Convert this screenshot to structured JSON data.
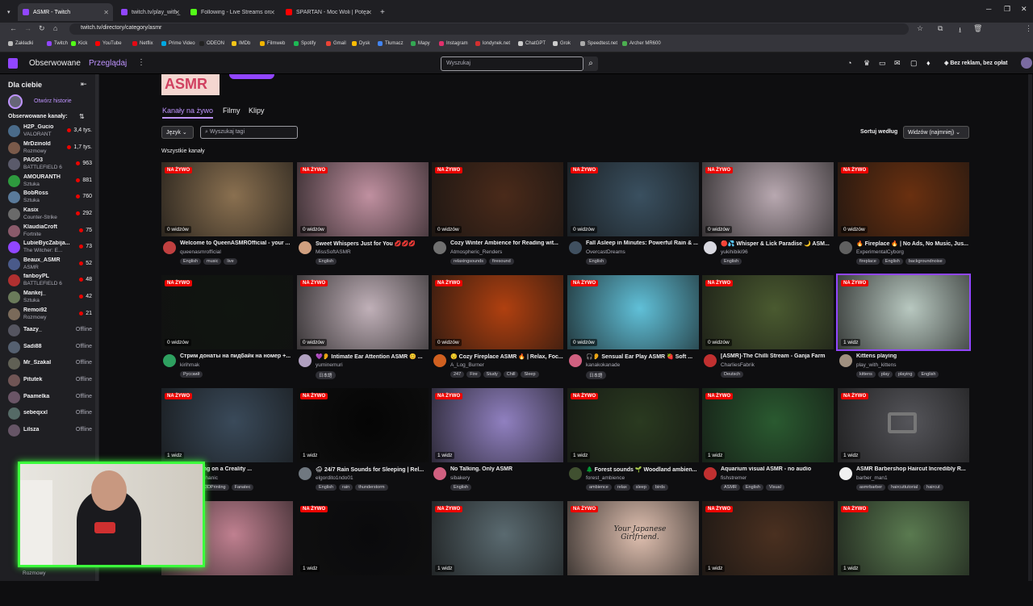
{
  "browser": {
    "tabs": [
      {
        "label": "ASMR - Twitch",
        "color": "#9146ff"
      },
      {
        "label": "twitch.tv/play_with_",
        "color": "#9146ff"
      },
      {
        "label": "Following - Live Streams on Kick",
        "color": "#53fc18"
      },
      {
        "label": "SPARTAN - Moc Woli | Potężna",
        "color": "#ff0000"
      }
    ],
    "url": "twitch.tv/directory/category/asmr",
    "bookmarks": [
      {
        "label": "Zakładki",
        "color": "#bbbbbb"
      },
      {
        "label": "Twitch",
        "color": "#9146ff"
      },
      {
        "label": "Kick",
        "color": "#53fc18"
      },
      {
        "label": "YouTube",
        "color": "#ff0000"
      },
      {
        "label": "Netflix",
        "color": "#e50914"
      },
      {
        "label": "Prime Video",
        "color": "#00a8e1"
      },
      {
        "label": "ODEON",
        "color": "#222222"
      },
      {
        "label": "IMDb",
        "color": "#f5c518"
      },
      {
        "label": "Filmweb",
        "color": "#f0b400"
      },
      {
        "label": "Spotify",
        "color": "#1db954"
      },
      {
        "label": "Gmail",
        "color": "#ea4335"
      },
      {
        "label": "Dysk",
        "color": "#fbbc04"
      },
      {
        "label": "Tłumacz",
        "color": "#4285f4"
      },
      {
        "label": "Mapy",
        "color": "#34a853"
      },
      {
        "label": "Instagram",
        "color": "#e1306c"
      },
      {
        "label": "londynek.net",
        "color": "#d32f2f"
      },
      {
        "label": "ChatGPT",
        "color": "#cccccc"
      },
      {
        "label": "Grok",
        "color": "#cccccc"
      },
      {
        "label": "Speedtest.net",
        "color": "#aaaaaa"
      },
      {
        "label": "Archer MR600",
        "color": "#4caf50"
      }
    ]
  },
  "twitch_nav": {
    "following": "Obserwowane",
    "browse": "Przeglądaj",
    "search_placeholder": "Wyszukaj",
    "no_ads": "Bez reklam, bez opłat"
  },
  "sidebar": {
    "for_you": "Dla ciebie",
    "open_stories": "Otwórz historie",
    "followed_header": "Obserwowane kanały:",
    "channels": [
      {
        "name": "H2P_Gucio",
        "game": "VALORANT",
        "viewers": "3,4 tys.",
        "color": "#4a6b8a"
      },
      {
        "name": "MrDzinold",
        "game": "Rozmowy",
        "viewers": "1,7 tys.",
        "color": "#7a5a4a"
      },
      {
        "name": "PAGO3",
        "game": "BATTLEFIELD 6",
        "viewers": "963",
        "color": "#5a5a6a"
      },
      {
        "name": "AMOURANTH",
        "game": "Sztuka",
        "viewers": "881",
        "color": "#2e9a3e"
      },
      {
        "name": "BobRoss",
        "game": "Sztuka",
        "viewers": "760",
        "color": "#5a7a9a"
      },
      {
        "name": "Kasix",
        "game": "Counter-Strike",
        "viewers": "292",
        "color": "#6a6a6a"
      },
      {
        "name": "KlaudiaCroft",
        "game": "Fortnite",
        "viewers": "75",
        "color": "#8a5a6a"
      },
      {
        "name": "LubieBycZabija...",
        "game": "The Witcher: E...",
        "viewers": "73",
        "color": "#9146ff"
      },
      {
        "name": "Beaux_ASMR",
        "game": "ASMR",
        "viewers": "52",
        "color": "#4a5a8a"
      },
      {
        "name": "fanboyPL",
        "game": "BATTLEFIELD 6",
        "viewers": "48",
        "color": "#b03030"
      },
      {
        "name": "Mankej_",
        "game": "Sztuka",
        "viewers": "42",
        "color": "#6a7a5a"
      },
      {
        "name": "Remoi92",
        "game": "Rozmowy",
        "viewers": "21",
        "color": "#7a6a5a"
      },
      {
        "name": "Taazy_",
        "game": "",
        "viewers": "Offline",
        "color": "#555560"
      },
      {
        "name": "Sadi88",
        "game": "",
        "viewers": "Offline",
        "color": "#556070"
      },
      {
        "name": "Mr_Szakal",
        "game": "",
        "viewers": "Offline",
        "color": "#606055"
      },
      {
        "name": "Pitutek",
        "game": "",
        "viewers": "Offline",
        "color": "#705555"
      },
      {
        "name": "Paamelka",
        "game": "",
        "viewers": "Offline",
        "color": "#6a5566"
      },
      {
        "name": "sebeqxxl",
        "game": "",
        "viewers": "Offline",
        "color": "#556a66"
      },
      {
        "name": "Lilsza",
        "game": "",
        "viewers": "Offline",
        "color": "#665566"
      }
    ]
  },
  "page": {
    "category_title": "ASMR",
    "tabs": [
      "Kanały na żywo",
      "Filmy",
      "Klipy"
    ],
    "lang_label": "Język",
    "tag_search_placeholder": "Wyszukaj tagi",
    "sort_label": "Sortuj według",
    "sort_value": "Widzów (najmniej)",
    "section_label": "Wszystkie kanały"
  },
  "live_badge": "NA ŻYWO",
  "streams": [
    {
      "title": "Welcome to QueenASMROfficial - your ...",
      "channel": "queenasmrofficial",
      "viewers": "0 widzów",
      "tags": [
        "English",
        "music",
        "live"
      ],
      "bg": "#8a7050",
      "av": "#c04040"
    },
    {
      "title": "Sweet Whispers Just for You 💋💋💋",
      "channel": "MissSoftASMR",
      "viewers": "0 widzów",
      "tags": [
        "English"
      ],
      "bg": "#c090a0",
      "av": "#d0a080"
    },
    {
      "title": "Cozy Winter Ambience for Reading wit...",
      "channel": "Atmospheric_Renders",
      "viewers": "0 widzów",
      "tags": [
        "relaxingsounds",
        "firesound"
      ],
      "bg": "#4a2a1a",
      "av": "#707070"
    },
    {
      "title": "Fall Asleep in Minutes: Powerful Rain & ...",
      "channel": "OvercastDreams",
      "viewers": "0 widzów",
      "tags": [
        "English"
      ],
      "bg": "#3a5060",
      "av": "#405060"
    },
    {
      "title": "🔴💦 Whisper & Lick Paradise 🌙 ASM...",
      "channel": "yukihibiki96",
      "viewers": "0 widzów",
      "tags": [
        "English"
      ],
      "bg": "#b8a8b0",
      "av": "#d8d8e0"
    },
    {
      "title": "🔥 Fireplace 🔥 | No Ads, No Music, Jus...",
      "channel": "ExperimentalCyborg",
      "viewers": "0 widzów",
      "tags": [
        "fireplace",
        "English",
        "backgroundnoise"
      ],
      "bg": "#6a3010",
      "av": "#606060"
    },
    {
      "title": "Стрим донаты на пидбайк на номер +...",
      "channel": "kirihmak",
      "viewers": "0 widzów",
      "tags": [
        "Русский"
      ],
      "bg": "#101510",
      "av": "#2ea060"
    },
    {
      "title": "💜👂 Intimate Ear Attention ASMR 😊 ...",
      "channel": "yuminemuri",
      "viewers": "0 widzów",
      "tags": [
        "日本語"
      ],
      "bg": "#c0b0b8",
      "av": "#b0a0c0"
    },
    {
      "title": "😌 Cozy Fireplace ASMR 🔥 | Relax, Foc...",
      "channel": "A_Log_Burner",
      "viewers": "0 widzów",
      "tags": [
        "247",
        "Fire",
        "Study",
        "Chill",
        "Sleep"
      ],
      "bg": "#b04010",
      "av": "#d06020"
    },
    {
      "title": "🎧👂 Sensual Ear Play ASMR 🍓 Soft ...",
      "channel": "kanakokanade",
      "viewers": "0 widzów",
      "tags": [
        "日本語"
      ],
      "bg": "#60c0d8",
      "av": "#d06080"
    },
    {
      "title": "[ASMR]-The Chilli Stream - Ganja Farm",
      "channel": "CharliesFabrik",
      "viewers": "0 widzów",
      "tags": [
        "Deutsch"
      ],
      "bg": "#4a5a30",
      "av": "#c03030"
    },
    {
      "title": "Kittens playing",
      "channel": "play_with_kittens",
      "viewers": "1 widz",
      "tags": [
        "kittens",
        "play",
        "playing",
        "English"
      ],
      "bg": "#b8c8c0",
      "av": "#a09080"
    },
    {
      "title": "3D Printing on a Creality ...",
      "channel": "PlasticMechanic",
      "viewers": "1 widz",
      "tags": [
        "ASMR",
        "3DPrinting",
        "Fanatec"
      ],
      "bg": "#3a4a5a",
      "av": "#506070"
    },
    {
      "title": "🌧 24/7 Rain Sounds for Sleeping | Rel...",
      "channel": "elgordito1ndo01",
      "viewers": "1 widz",
      "tags": [
        "English",
        "rain",
        "thunderstorm"
      ],
      "bg": "#050505",
      "av": "#707880"
    },
    {
      "title": "No Talking. Only ASMR",
      "channel": "sibakery",
      "viewers": "1 widz",
      "tags": [
        "English"
      ],
      "bg": "#9080c0",
      "av": "#d06080"
    },
    {
      "title": "🌲 Forest sounds 🌱 Woodland ambien...",
      "channel": "forest_ambience",
      "viewers": "1 widz",
      "tags": [
        "ambience",
        "relax",
        "sleep",
        "birds"
      ],
      "bg": "#2a3a20",
      "av": "#405030"
    },
    {
      "title": "Aquarium visual ASMR - no audio",
      "channel": "fishstremer",
      "viewers": "1 widz",
      "tags": [
        "ASMR",
        "English",
        "Visual"
      ],
      "bg": "#2a5a30",
      "av": "#c03030"
    },
    {
      "title": "ASMR Barbershop Haircut Incredibly R...",
      "channel": "barber_man1",
      "viewers": "1 widz",
      "tags": [
        "asmrbarber",
        "haircuttutorial",
        "haircut"
      ],
      "bg": "#55555a",
      "av": "#f0f0f0"
    },
    {
      "title": "",
      "channel": "",
      "viewers": "",
      "tags": [],
      "bg": "#c08090",
      "av": "#806070"
    },
    {
      "title": "",
      "channel": "",
      "viewers": "1 widz",
      "tags": [],
      "bg": "#0a0a0c",
      "av": "#505050"
    },
    {
      "title": "",
      "channel": "",
      "viewers": "1 widz",
      "tags": [],
      "bg": "#5a6a70",
      "av": "#505050"
    },
    {
      "title": "",
      "channel": "",
      "viewers": "",
      "tags": [],
      "bg": "#e0c0b0",
      "av": "#505050"
    },
    {
      "title": "",
      "channel": "",
      "viewers": "1 widz",
      "tags": [],
      "bg": "#4a3020",
      "av": "#505050"
    },
    {
      "title": "",
      "channel": "",
      "viewers": "1 widz",
      "tags": [],
      "bg": "#5a7a50",
      "av": "#505050"
    }
  ],
  "overlay_thumb_texts": {
    "japanese_gf": "Your Japanese Girlfriend."
  },
  "webcam_label": "Rozmowy"
}
